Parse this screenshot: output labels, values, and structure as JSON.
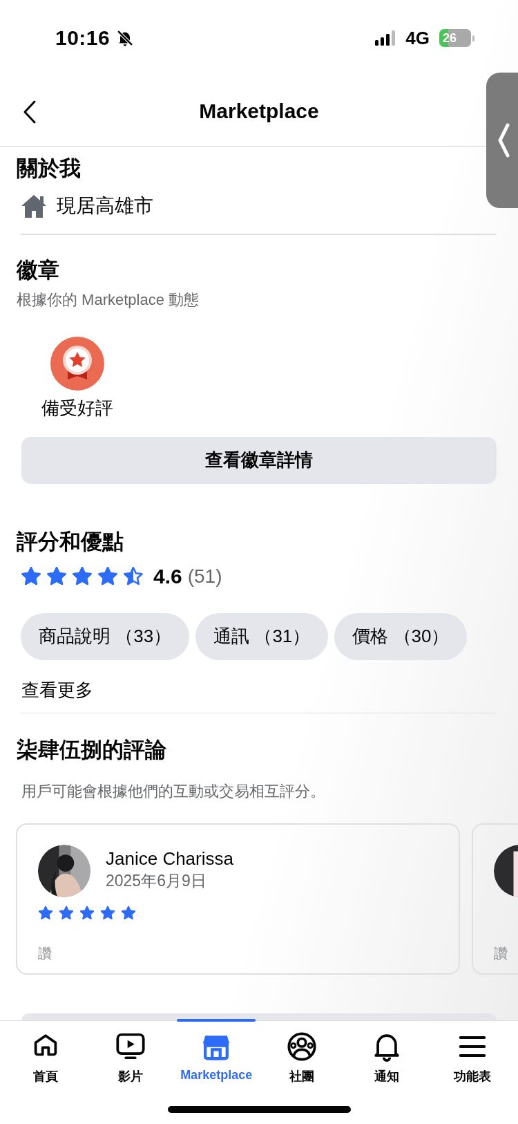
{
  "status_bar": {
    "time": "10:16",
    "silent": true,
    "network": "4G",
    "battery": "26"
  },
  "header": {
    "title": "Marketplace"
  },
  "about": {
    "title": "關於我",
    "items": [
      {
        "kind": "home",
        "text": "現居高雄市"
      }
    ]
  },
  "badges": {
    "title": "徽章",
    "subtitle": "根據你的 Marketplace 動態",
    "items": [
      {
        "label": "備受好評"
      }
    ],
    "button": "查看徽章詳情"
  },
  "ratings": {
    "title": "評分和優點",
    "stars": 4.5,
    "score": "4.6",
    "count": "(51)",
    "tags": [
      {
        "label": "商品說明 （33）"
      },
      {
        "label": "通訊 （31）"
      },
      {
        "label": "價格 （30）"
      }
    ],
    "more": "查看更多"
  },
  "reviews": {
    "title": "柒肆伍捌的評論",
    "subtitle": "用戶可能會根據他們的互動或交易相互評分。",
    "items": [
      {
        "name": "Janice Charissa",
        "date": "2025年6月9日",
        "stars": 5,
        "text": "讚"
      },
      {
        "text": "讚"
      }
    ]
  },
  "bottom_nav": [
    {
      "kind": "home",
      "label": "首頁",
      "selected": false
    },
    {
      "kind": "video",
      "label": "影片",
      "selected": false
    },
    {
      "kind": "marketplace",
      "label": "Marketplace",
      "selected": true
    },
    {
      "kind": "groups",
      "label": "社團",
      "selected": false
    },
    {
      "kind": "bell",
      "label": "通知",
      "selected": false
    },
    {
      "kind": "menu",
      "label": "功能表",
      "selected": false
    }
  ]
}
